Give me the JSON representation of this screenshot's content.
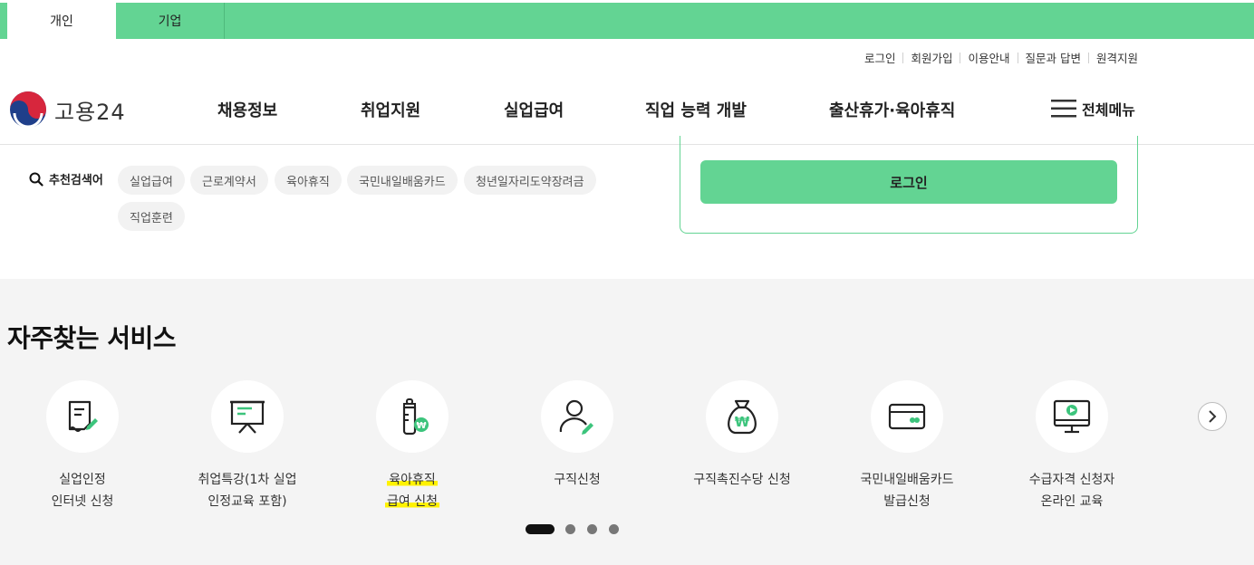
{
  "top_tabs": [
    {
      "label": "개인",
      "active": true
    },
    {
      "label": "기업",
      "active": false
    }
  ],
  "utility_links": [
    "로그인",
    "회원가입",
    "이용안내",
    "질문과 답변",
    "원격지원"
  ],
  "logo": {
    "name": "고용24"
  },
  "gnb": [
    "채용정보",
    "취업지원",
    "실업급여",
    "직업 능력 개발",
    "출산휴가·육아휴직"
  ],
  "all_menu": {
    "label": "전체메뉴",
    "icon": "hamburger-icon"
  },
  "recommend": {
    "label": "추천검색어",
    "icon": "search-icon",
    "chips": [
      "실업급여",
      "근로계약서",
      "육아휴직",
      "국민내일배움카드",
      "청년일자리도약장려금",
      "직업훈련"
    ]
  },
  "login": {
    "button": "로그인"
  },
  "services": {
    "title": "자주찾는 서비스",
    "items": [
      {
        "line1": "실업인정",
        "line2": "인터넷 신청",
        "icon": "document-edit-icon"
      },
      {
        "line1": "취업특강(1차 실업",
        "line2": "인정교육 포함)",
        "icon": "presentation-board-icon"
      },
      {
        "line1": "육아휴직",
        "line2": "급여 신청",
        "icon": "baby-bottle-won-icon",
        "highlighted": true
      },
      {
        "line1": "구직신청",
        "line2": "",
        "icon": "person-edit-icon"
      },
      {
        "line1": "구직촉진수당 신청",
        "line2": "",
        "icon": "money-bag-icon"
      },
      {
        "line1": "국민내일배움카드",
        "line2": "발급신청",
        "icon": "card-icon"
      },
      {
        "line1": "수급자격 신청자",
        "line2": "온라인 교육",
        "icon": "monitor-play-icon"
      }
    ],
    "next_icon": "chevron-right-icon",
    "pagination": {
      "total": 4,
      "current": 1
    }
  },
  "colors": {
    "brand_green": "#63d493",
    "accent_green": "#3cc47c",
    "highlight": "#fff200"
  }
}
